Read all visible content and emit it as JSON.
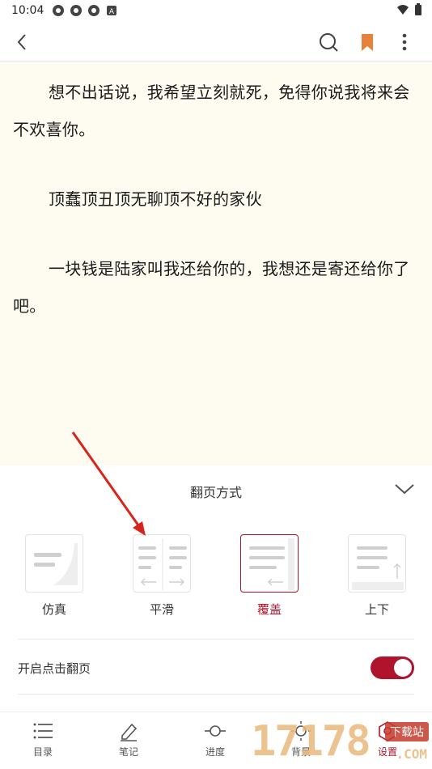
{
  "status": {
    "time": "10:04"
  },
  "reader": {
    "paragraphs": [
      "想不出话说，我希望立刻就死，免得你说我将来会不欢喜你。",
      "顶蠢顶丑顶无聊顶不好的家伙",
      "一块钱是陆家叫我还给你的，我想还是寄还给你了吧。"
    ]
  },
  "panel": {
    "title": "翻页方式",
    "modes": [
      {
        "label": "仿真",
        "active": false
      },
      {
        "label": "平滑",
        "active": false
      },
      {
        "label": "覆盖",
        "active": true
      },
      {
        "label": "上下",
        "active": false
      }
    ],
    "tap_to_turn_label": "开启点击翻页",
    "tap_to_turn_enabled": true
  },
  "nav": {
    "items": [
      {
        "label": "目录",
        "icon": "list-icon"
      },
      {
        "label": "笔记",
        "icon": "pencil-icon"
      },
      {
        "label": "进度",
        "icon": "progress-icon"
      },
      {
        "label": "背景",
        "icon": "brightness-icon"
      },
      {
        "label": "设置",
        "icon": "settings-icon"
      }
    ]
  },
  "watermark": {
    "number": "17178",
    "badge": "下载站",
    "suffix": ".COM"
  },
  "colors": {
    "accent": "#b0142c",
    "reader_bg": "#fefcf0"
  },
  "icons": {
    "back": "back-arrow-icon",
    "search": "search-icon",
    "bookmark": "bookmark-icon",
    "more": "more-vert-icon",
    "collapse": "chevron-down-icon"
  }
}
